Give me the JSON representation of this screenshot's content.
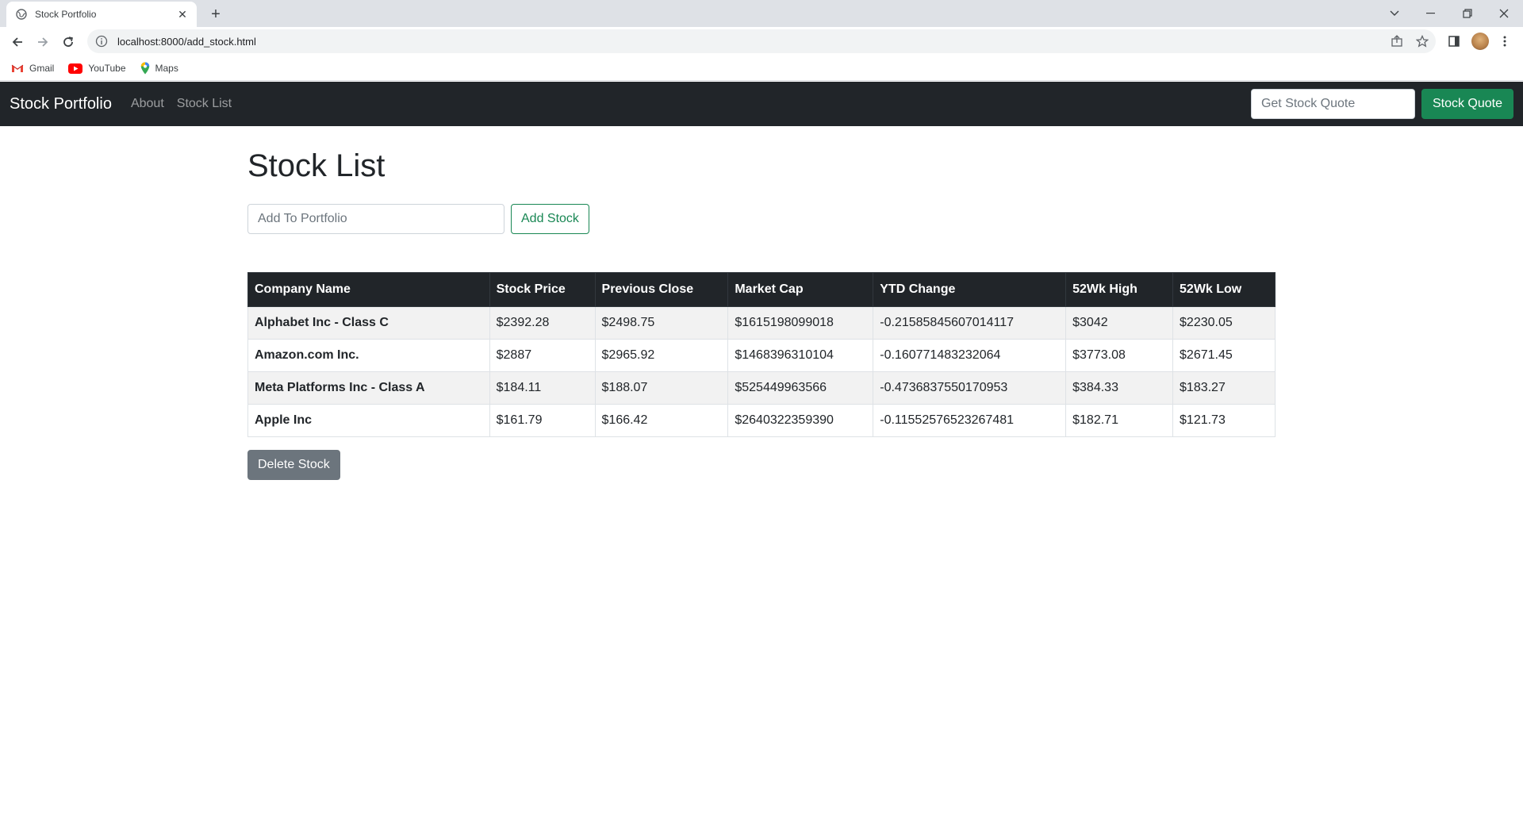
{
  "browser": {
    "tab_title": "Stock Portfolio",
    "tab_close": "✕",
    "new_tab": "+",
    "url": "localhost:8000/add_stock.html",
    "bookmarks": [
      {
        "label": "Gmail",
        "icon": "gmail-icon"
      },
      {
        "label": "YouTube",
        "icon": "youtube-icon"
      },
      {
        "label": "Maps",
        "icon": "maps-icon"
      }
    ]
  },
  "navbar": {
    "brand": "Stock Portfolio",
    "links": [
      "About",
      "Stock List"
    ],
    "quote_placeholder": "Get Stock Quote",
    "quote_button": "Stock Quote"
  },
  "page": {
    "title": "Stock List",
    "add_placeholder": "Add To Portfolio",
    "add_button": "Add Stock",
    "delete_button": "Delete Stock"
  },
  "table": {
    "headers": [
      "Company Name",
      "Stock Price",
      "Previous Close",
      "Market Cap",
      "YTD Change",
      "52Wk High",
      "52Wk Low"
    ],
    "rows": [
      [
        "Alphabet Inc - Class C",
        "$2392.28",
        "$2498.75",
        "$1615198099018",
        "-0.21585845607014117",
        "$3042",
        "$2230.05"
      ],
      [
        "Amazon.com Inc.",
        "$2887",
        "$2965.92",
        "$1468396310104",
        "-0.160771483232064",
        "$3773.08",
        "$2671.45"
      ],
      [
        "Meta Platforms Inc - Class A",
        "$184.11",
        "$188.07",
        "$525449963566",
        "-0.4736837550170953",
        "$384.33",
        "$183.27"
      ],
      [
        "Apple Inc",
        "$161.79",
        "$166.42",
        "$2640322359390",
        "-0.11552576523267481",
        "$182.71",
        "$121.73"
      ]
    ]
  },
  "colors": {
    "navbar_bg": "#212529",
    "success": "#198754",
    "secondary": "#6c757d"
  }
}
